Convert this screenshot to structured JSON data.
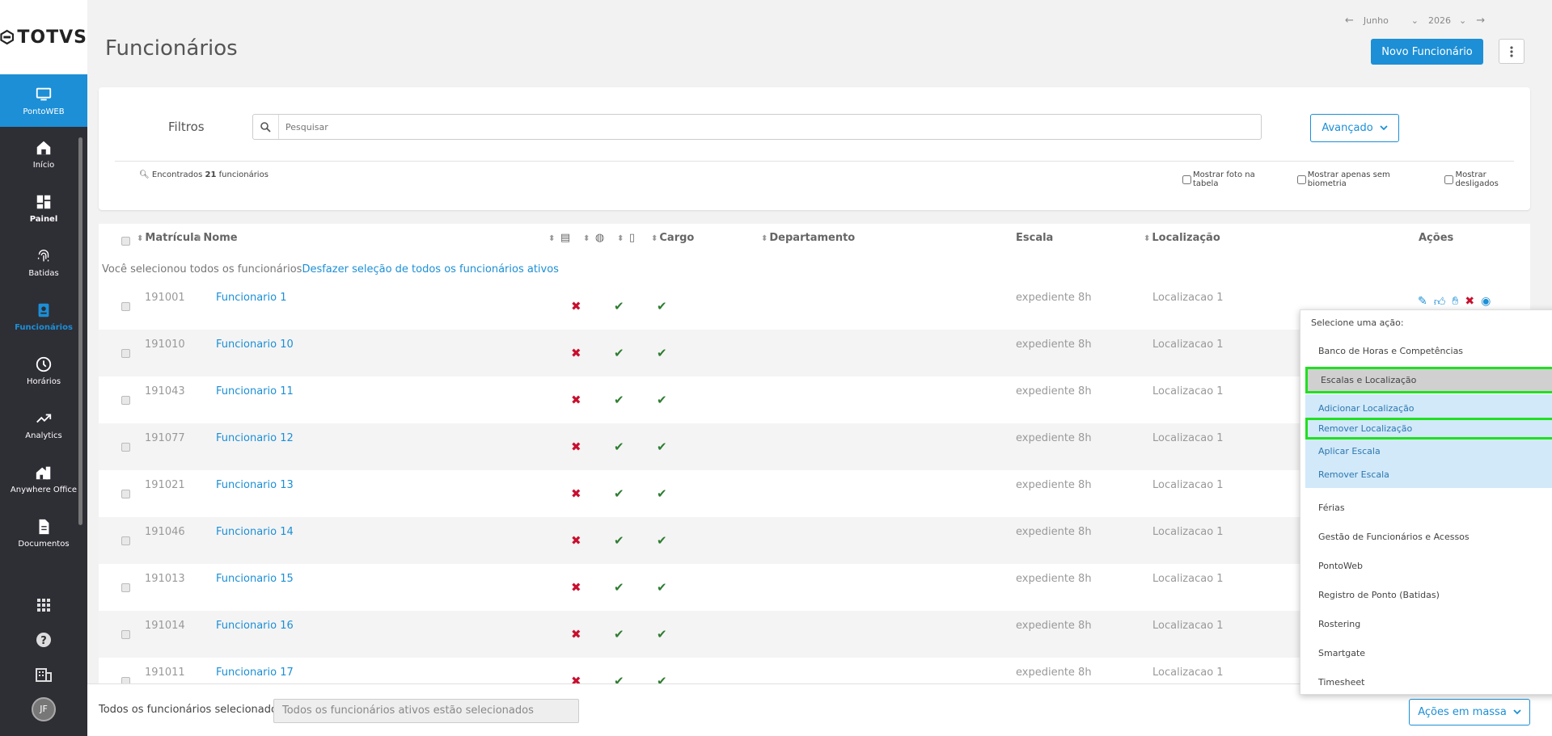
{
  "sidebar": {
    "logo": "TOTVS",
    "items": [
      {
        "label": "PontoWEB",
        "icon": "monitor-icon"
      },
      {
        "label": "Início",
        "icon": "home-icon"
      },
      {
        "label": "Painel",
        "icon": "dashboard-icon"
      },
      {
        "label": "Batidas",
        "icon": "fingerprint-icon"
      },
      {
        "label": "Funcionários",
        "icon": "badge-icon"
      },
      {
        "label": "Horários",
        "icon": "clock-icon"
      },
      {
        "label": "Analytics",
        "icon": "trending-icon"
      },
      {
        "label": "Anywhere Office",
        "icon": "house-icon"
      },
      {
        "label": "Documentos",
        "icon": "document-icon"
      }
    ],
    "avatar": "JF"
  },
  "header": {
    "title": "Funcionários",
    "month": "Junho",
    "year": "2026",
    "new_button": "Novo Funcionário"
  },
  "filters": {
    "label": "Filtros",
    "search_placeholder": "Pesquisar",
    "advanced": "Avançado",
    "found_prefix": "Encontrados",
    "found_count": "21",
    "found_suffix": "funcionários",
    "checkboxes": [
      "Mostrar foto na tabela",
      "Mostrar apenas sem biometria",
      "Mostrar desligados"
    ]
  },
  "table": {
    "headers": {
      "matricula": "Matrícula",
      "nome": "Nome",
      "cargo": "Cargo",
      "departamento": "Departamento",
      "escala": "Escala",
      "localizacao": "Localização",
      "acoes": "Ações"
    },
    "notice_text": "Você selecionou todos os funcionários",
    "notice_link": "Desfazer seleção de todos os funcionários ativos",
    "rows": [
      {
        "mat": "191001",
        "name": "Funcionario 1",
        "escala": "expediente 8h",
        "loc": "Localizacao 1"
      },
      {
        "mat": "191010",
        "name": "Funcionario 10",
        "escala": "expediente 8h",
        "loc": "Localizacao 1"
      },
      {
        "mat": "191043",
        "name": "Funcionario 11",
        "escala": "expediente 8h",
        "loc": "Localizacao 1"
      },
      {
        "mat": "191077",
        "name": "Funcionario 12",
        "escala": "expediente 8h",
        "loc": "Localizacao 1"
      },
      {
        "mat": "191021",
        "name": "Funcionario 13",
        "escala": "expediente 8h",
        "loc": "Localizacao 1"
      },
      {
        "mat": "191046",
        "name": "Funcionario 14",
        "escala": "expediente 8h",
        "loc": "Localizacao 1"
      },
      {
        "mat": "191013",
        "name": "Funcionario 15",
        "escala": "expediente 8h",
        "loc": "Localizacao 1"
      },
      {
        "mat": "191014",
        "name": "Funcionario 16",
        "escala": "expediente 8h",
        "loc": "Localizacao 1"
      },
      {
        "mat": "191011",
        "name": "Funcionario 17",
        "escala": "expediente 8h",
        "loc": "Localizacao 1"
      }
    ]
  },
  "footer": {
    "selected_label": "Todos os funcionários selecionados",
    "selected_value": "Todos os funcionários ativos estão selecionados",
    "mass_actions": "Ações em massa"
  },
  "dropdown": {
    "header": "Selecione uma ação:",
    "groups": [
      "Banco de Horas e Competências",
      "Escalas e Localização",
      "Férias",
      "Gestão de Funcionários e Acessos",
      "PontoWeb",
      "Registro de Ponto (Batidas)",
      "Rostering",
      "Smartgate",
      "Timesheet"
    ],
    "sub_items": [
      "Adicionar Localização",
      "Remover Localização",
      "Aplicar Escala",
      "Remover Escala"
    ]
  },
  "colors": {
    "accent": "#1c8fd6",
    "sidebar": "#2e2e35",
    "highlight": "#20e020",
    "error": "#c8102e",
    "success": "#2e7d32"
  }
}
